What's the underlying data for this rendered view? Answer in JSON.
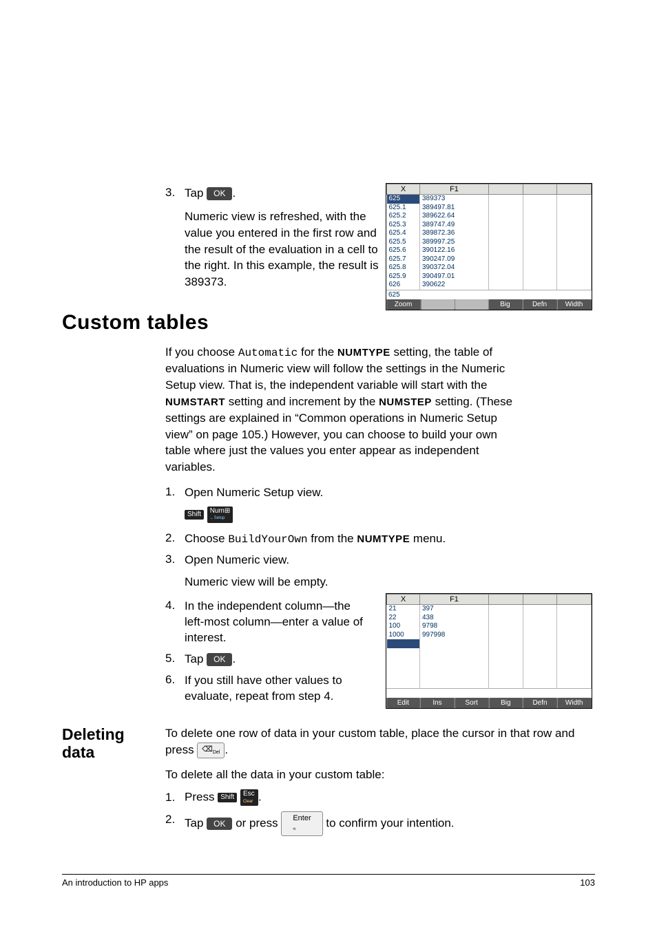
{
  "step3": {
    "marker": "3.",
    "text": "Tap ",
    "button": "OK",
    "after": ".",
    "para": "Numeric view is refreshed, with the value you entered in the first row and the result of the evaluation in a cell to the right. In this example, the result is 389373."
  },
  "calc1": {
    "headers": [
      "X",
      "F1",
      "",
      "",
      ""
    ],
    "rows": [
      {
        "x": "625",
        "f1": "389373",
        "sel": true
      },
      {
        "x": "625.1",
        "f1": "389497.81"
      },
      {
        "x": "625.2",
        "f1": "389622.64"
      },
      {
        "x": "625.3",
        "f1": "389747.49"
      },
      {
        "x": "625.4",
        "f1": "389872.36"
      },
      {
        "x": "625.5",
        "f1": "389997.25"
      },
      {
        "x": "625.6",
        "f1": "390122.16"
      },
      {
        "x": "625.7",
        "f1": "390247.09"
      },
      {
        "x": "625.8",
        "f1": "390372.04"
      },
      {
        "x": "625.9",
        "f1": "390497.01"
      },
      {
        "x": "626",
        "f1": "390622"
      }
    ],
    "entry": "625",
    "menu": [
      "Zoom",
      "",
      "",
      "Big",
      "Defn",
      "Width"
    ]
  },
  "section_heading": "Custom tables",
  "custom_intro_1": "If you choose ",
  "custom_intro_mono": "Automatic",
  "custom_intro_2": " for the ",
  "custom_intro_numtype": "NUMTYPE",
  "custom_intro_3": " setting, the table of evaluations in Numeric view will follow the settings in the Numeric Setup view. That is, the independent variable will start with the ",
  "custom_intro_numstart": "NUMSTART",
  "custom_intro_4": " setting and increment by the ",
  "custom_intro_numstep": "NUMSTEP",
  "custom_intro_5": " setting. (These settings are explained in “Common operations in Numeric Setup view” on page 105.) However, you can choose to build your own table where just the values you enter appear as independent variables.",
  "steps": {
    "s1": {
      "m": "1.",
      "t": "Open Numeric Setup view."
    },
    "keys1": {
      "shift": "Shift",
      "num": "Num⊞",
      "sub": "←Setup"
    },
    "s2": {
      "m": "2.",
      "t1": "Choose ",
      "mono": "BuildYourOwn",
      "t2": " from the ",
      "sc": "NUMTYPE",
      "t3": " menu."
    },
    "s3": {
      "m": "3.",
      "t": "Open Numeric view."
    },
    "s3b": "Numeric view will be empty.",
    "s4": {
      "m": "4.",
      "t": "In the independent column—the left-most column—enter a value of interest."
    },
    "s5": {
      "m": "5.",
      "t1": "Tap ",
      "btn": "OK",
      "t2": "."
    },
    "s6": {
      "m": "6.",
      "t": "If you still have other values to evaluate, repeat from step 4."
    }
  },
  "calc2": {
    "headers": [
      "X",
      "F1",
      "",
      "",
      ""
    ],
    "rows": [
      {
        "x": "21",
        "f1": "397"
      },
      {
        "x": "22",
        "f1": "438"
      },
      {
        "x": "100",
        "f1": "9798"
      },
      {
        "x": "1000",
        "f1": "997998"
      }
    ],
    "entry": "",
    "menu": [
      "Edit",
      "Ins",
      "Sort",
      "Big",
      "Defn",
      "Width"
    ]
  },
  "deleting": {
    "heading": "Deleting data",
    "p1a": "To delete one row of data in your custom table, place the cursor in that row and press ",
    "p1b": ".",
    "p2": "To delete all the data in your custom table:",
    "s1": {
      "m": "1.",
      "t1": "Press ",
      "k1": "Shift",
      "k2": "Esc",
      "k2sub": "Clear",
      "t2": "."
    },
    "s2": {
      "m": "2.",
      "t1": "Tap ",
      "btn": "OK",
      "t2": " or press ",
      "enter": "Enter",
      "entersub": "≈",
      "t3": " to confirm your intention."
    }
  },
  "footer": {
    "left": "An introduction to HP apps",
    "right": "103"
  }
}
